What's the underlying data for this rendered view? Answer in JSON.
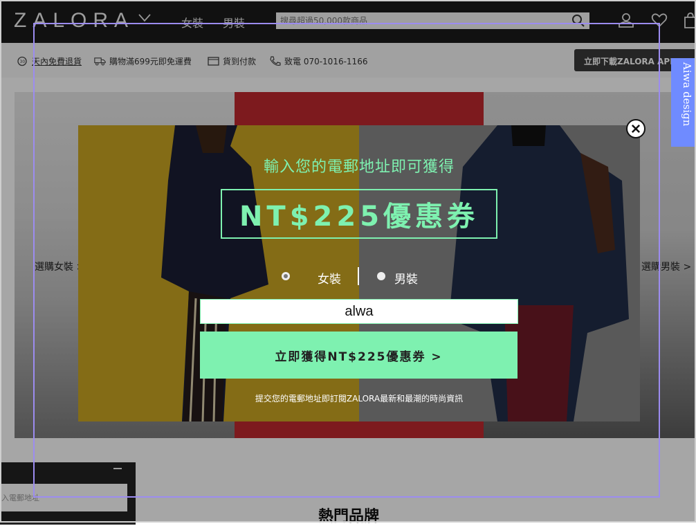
{
  "header": {
    "logo": "ZALORA",
    "nav": [
      "女裝",
      "男裝"
    ],
    "search_placeholder": "搜尋超過50,000款商品"
  },
  "info_bar": {
    "items": [
      "天內免費退貨",
      "購物滿699元即免運費",
      "貨到付款",
      "致電 070-1016-1166"
    ],
    "app_button": "立即下載ZALORA APP"
  },
  "page": {
    "hero_left_caption": "選購女裝 >",
    "hero_right_caption": "選購男裝 >",
    "brands_title": "熱門品牌",
    "chat_placeholder": "入電郵地址"
  },
  "popup": {
    "headline": "輸入您的電郵地址即可獲得",
    "coupon": "NT$225優惠券",
    "gender_options": [
      "女裝",
      "男裝"
    ],
    "selected_gender": "女裝",
    "email_value": "alwa",
    "cta": "立即獲得NT$225優惠券 >",
    "note": "提交您的電郵地址即訂閱ZALORA最新和最潮的時尚資訊"
  },
  "overlay": {
    "side_tab": "Aiwa design"
  },
  "colors": {
    "accent_green": "#7ef1b0",
    "header_bg": "#1b1b1b",
    "hero_red": "#c0282f",
    "popup_left_bg": "#c3a021",
    "selection_frame": "#9c8cf0",
    "side_tab": "#6f8bff"
  }
}
